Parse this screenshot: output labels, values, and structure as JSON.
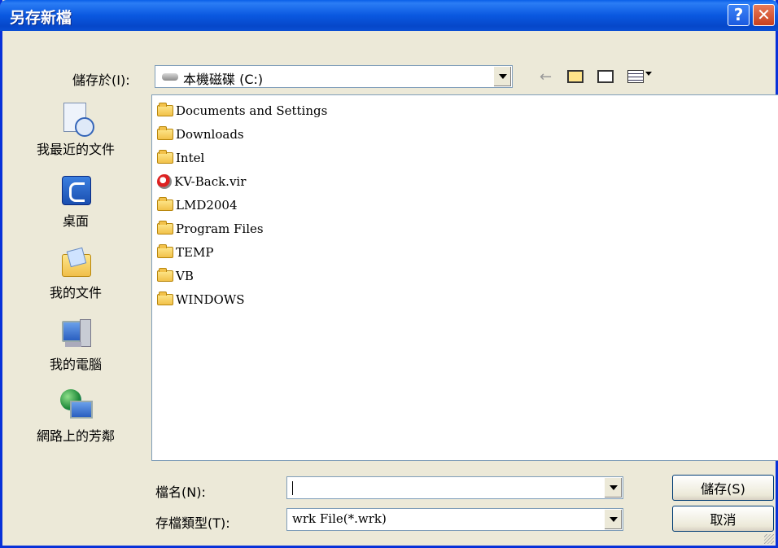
{
  "window": {
    "title": "另存新檔"
  },
  "titlebar": {
    "help_glyph": "?",
    "close_glyph": "✕"
  },
  "toolbar": {
    "save_in_label": "儲存於(I):",
    "save_in_value": "本機磁碟 (C:)",
    "drive_icon": "hard-drive-icon",
    "back_icon": "back-arrow-icon",
    "up_icon": "up-folder-icon",
    "new_folder_icon": "new-folder-icon",
    "view_icon": "view-menu-icon"
  },
  "places": [
    {
      "label": "我最近的文件",
      "icon": "recent-documents-icon"
    },
    {
      "label": "桌面",
      "icon": "desktop-icon"
    },
    {
      "label": "我的文件",
      "icon": "my-documents-icon"
    },
    {
      "label": "我的電腦",
      "icon": "my-computer-icon"
    },
    {
      "label": "網路上的芳鄰",
      "icon": "network-places-icon"
    }
  ],
  "files": [
    {
      "name": "Documents and Settings",
      "type": "folder"
    },
    {
      "name": "Downloads",
      "type": "folder"
    },
    {
      "name": "Intel",
      "type": "folder"
    },
    {
      "name": "KV-Back.vir",
      "type": "file"
    },
    {
      "name": "LMD2004",
      "type": "folder"
    },
    {
      "name": "Program Files",
      "type": "folder"
    },
    {
      "name": "TEMP",
      "type": "folder"
    },
    {
      "name": "VB",
      "type": "folder"
    },
    {
      "name": "WINDOWS",
      "type": "folder"
    }
  ],
  "form": {
    "filename_label": "檔名(N):",
    "filename_value": "",
    "filetype_label": "存檔類型(T):",
    "filetype_value": "wrk File(*.wrk)"
  },
  "buttons": {
    "save": "儲存(S)",
    "cancel": "取消"
  }
}
